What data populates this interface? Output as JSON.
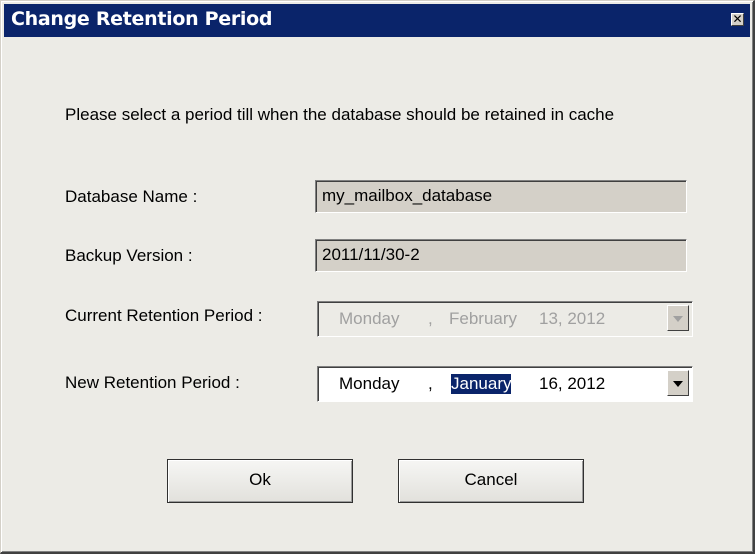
{
  "window": {
    "title": "Change Retention Period",
    "close_glyph": "✕"
  },
  "instruction": "Please select a period till when the database should be retained in cache",
  "fields": {
    "database_name": {
      "label": "Database Name :",
      "value": "my_mailbox_database"
    },
    "backup_version": {
      "label": "Backup Version :",
      "value": "2011/11/30-2"
    },
    "current_period": {
      "label": "Current Retention Period :",
      "weekday": "Monday",
      "comma": ",",
      "month": "February",
      "day_year": "13, 2012"
    },
    "new_period": {
      "label": "New Retention Period :",
      "weekday": "Monday",
      "comma": ",",
      "month": "January",
      "day_year": "16, 2012"
    }
  },
  "buttons": {
    "ok": "Ok",
    "cancel": "Cancel"
  },
  "colors": {
    "titlebar": "#0a246a",
    "dialog_bg": "#ecebe6",
    "selection": "#0a246a"
  }
}
